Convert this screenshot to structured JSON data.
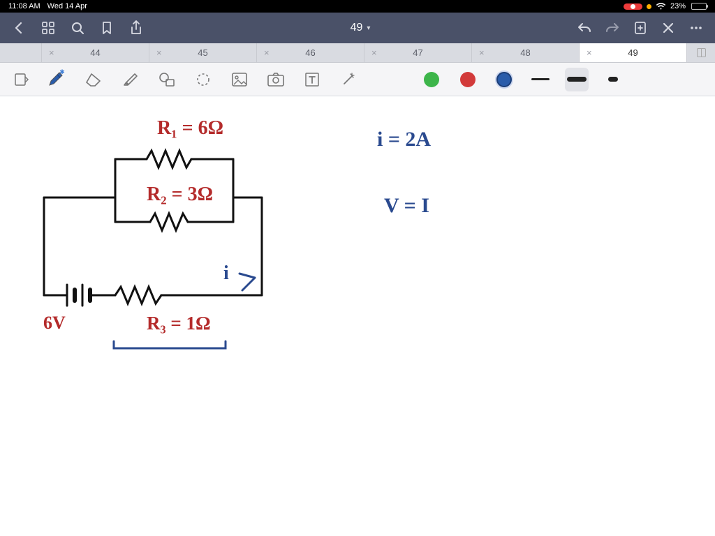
{
  "status": {
    "time": "11:08 AM",
    "date": "Wed 14 Apr",
    "battery_pct": "23%"
  },
  "toolbar": {
    "title": "49"
  },
  "tabs": {
    "items": [
      {
        "label": "44"
      },
      {
        "label": "45"
      },
      {
        "label": "46"
      },
      {
        "label": "47"
      },
      {
        "label": "48"
      },
      {
        "label": "49"
      }
    ],
    "active_index": 5
  },
  "notes": {
    "r1": "R₁ = 6Ω",
    "r2": "R₂ = 3Ω",
    "r3": "R₃ = 1Ω",
    "v_src": "6V",
    "i_lbl": "i",
    "eq1": "i = 2A",
    "eq2": "V = I"
  }
}
